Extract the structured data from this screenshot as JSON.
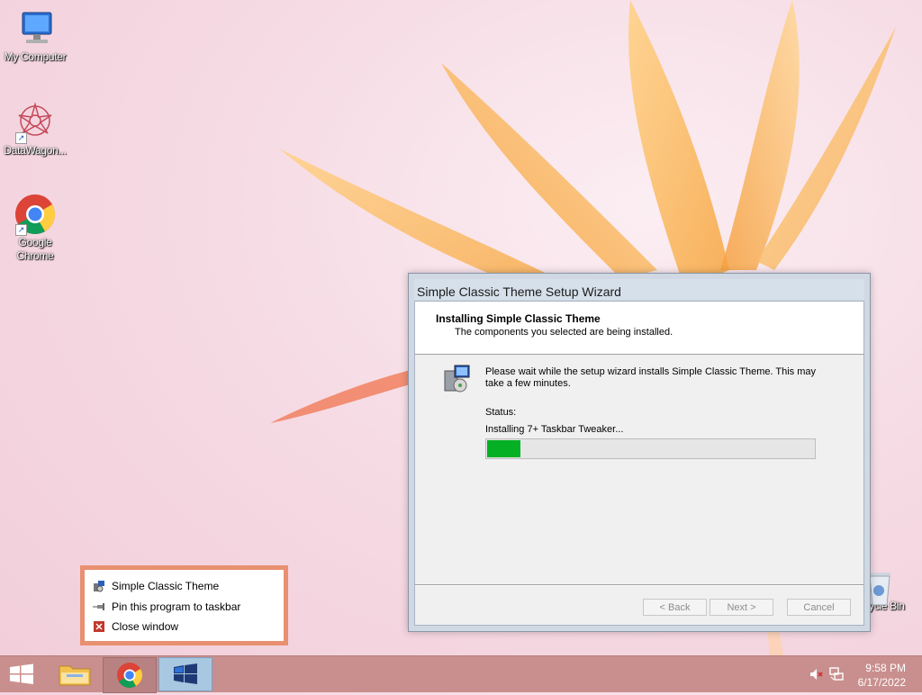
{
  "desktop": {
    "icons": [
      {
        "label": "My Computer",
        "icon": "computer-icon"
      },
      {
        "label": "DataWagon...",
        "icon": "datawagon-icon"
      },
      {
        "label": "Google\nChrome",
        "label_line1": "Google",
        "label_line2": "Chrome",
        "icon": "chrome-icon"
      },
      {
        "label": "ycle Bin",
        "icon": "recycle-bin-icon"
      }
    ]
  },
  "wizard": {
    "title": "Simple Classic Theme Setup Wizard",
    "header_title": "Installing Simple Classic Theme",
    "header_subtitle": "The components you selected are being installed.",
    "message": "Please wait while the setup wizard installs Simple Classic Theme. This may take a few minutes.",
    "status_label": "Status:",
    "status_text": "Installing 7+ Taskbar Tweaker...",
    "progress": 0.1,
    "buttons": {
      "back": "< Back",
      "next": "Next >",
      "cancel": "Cancel"
    },
    "progress_color": "#06b025"
  },
  "popup": {
    "items": [
      {
        "label": "Simple Classic Theme",
        "icon": "setup-app-icon"
      },
      {
        "label": "Pin this program to taskbar",
        "icon": "pin-icon"
      },
      {
        "label": "Close window",
        "icon": "close-icon"
      }
    ]
  },
  "taskbar": {
    "time": "9:58 PM",
    "date": "6/17/2022",
    "items": [
      "start-button",
      "file-explorer",
      "google-chrome",
      "simple-classic-theme-setup"
    ]
  },
  "colors": {
    "taskbar": "#c98f8e",
    "popup_border": "#e89070",
    "accent": "#a8c7e0"
  }
}
